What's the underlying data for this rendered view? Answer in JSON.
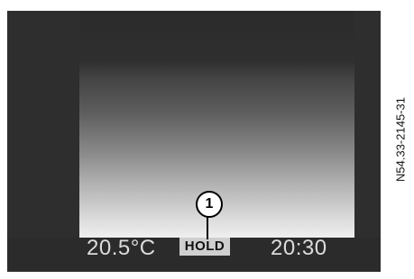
{
  "display": {
    "temperature": "20.5°C",
    "mode_badge": "HOLD",
    "time": "20:30"
  },
  "callout": {
    "number": "1"
  },
  "figure_code": "N54.33-2145-31"
}
